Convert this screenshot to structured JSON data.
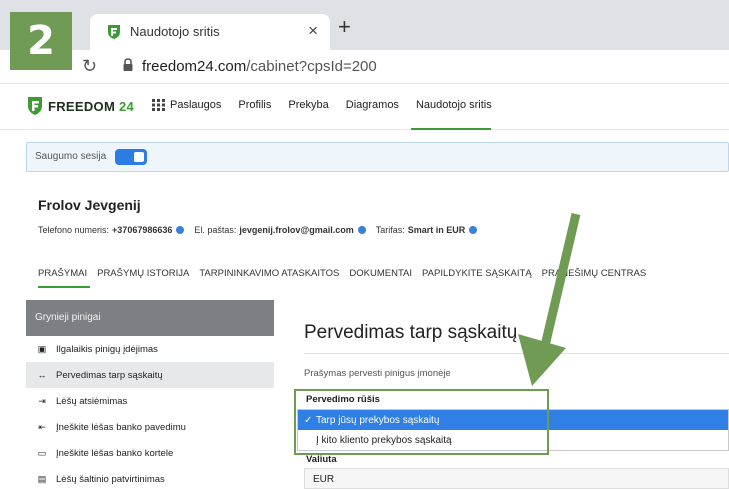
{
  "step_badge": "2",
  "browser": {
    "tab_title": "Naudotojo sritis",
    "close_glyph": "×",
    "new_tab_glyph": "+",
    "reload_glyph": "↻",
    "url_host": "freedom24.com",
    "url_path": "/cabinet?cpsId=200"
  },
  "site": {
    "logo_word": "FREEDOM",
    "logo_num": "24",
    "nav": [
      "Paslaugos",
      "Profilis",
      "Prekyba",
      "Diagramos",
      "Naudotojo sritis"
    ],
    "active_nav": "Naudotojo sritis",
    "accent_color": "#3d9b35"
  },
  "session": {
    "label": "Saugumo sesija",
    "enabled": true
  },
  "profile": {
    "name": "Frolov Jevgenij",
    "phone_label": "Telefono numeris:",
    "phone_value": "+37067986636",
    "email_label": "El. paštas:",
    "email_value": "jevgenij.frolov@gmail.com",
    "tariff_label": "Tarifas:",
    "tariff_value": "Smart in EUR"
  },
  "section_tabs": [
    "PRAŠYMAI",
    "PRAŠYMŲ ISTORIJA",
    "TARPININKAVIMO ATASKAITOS",
    "DOKUMENTAI",
    "PAPILDYKITE SĄSKAITĄ",
    "PRANEŠIMŲ CENTRAS"
  ],
  "left_menu": {
    "header": "Grynieji pinigai",
    "items": [
      {
        "label": "Ilgalaikis pinigų įdėjimas",
        "icon": "▣"
      },
      {
        "label": "Pervedimas tarp sąskaitų",
        "icon": "↔"
      },
      {
        "label": "Lėšų atsiėmimas",
        "icon": "⇥"
      },
      {
        "label": "Įneškite lėšas banko pavedimu",
        "icon": "⇤"
      },
      {
        "label": "Įneškite lėšas banko kortele",
        "icon": "▭"
      },
      {
        "label": "Lėšų šaltinio patvirtinimas",
        "icon": "▤"
      }
    ]
  },
  "form": {
    "title": "Pervedimas tarp sąskaitų",
    "subtitle": "Prašymas pervesti pinigus įmonėje",
    "transfer_type_label": "Pervedimo rūšis",
    "options": [
      {
        "label": "Tarp jūsų prekybos sąskaitų",
        "check": "✓"
      },
      {
        "label": "Į kito kliento prekybos sąskaitą",
        "check": ""
      }
    ],
    "currency_label": "Valiuta",
    "currency_value": "EUR"
  }
}
